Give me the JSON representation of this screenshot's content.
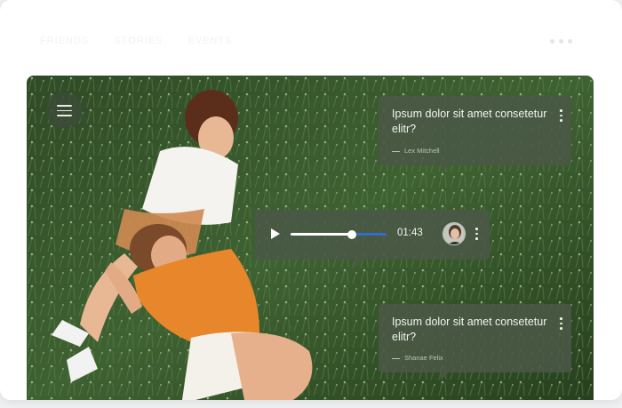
{
  "nav": {
    "items": [
      "FRIENDS",
      "STORIES",
      "EVENTS"
    ]
  },
  "messages": [
    {
      "text": "Ipsum dolor sit amet consetetur elitr?",
      "author": "Lex Mitchell"
    },
    {
      "text": "Ipsum dolor sit amet consetetur elitr?",
      "author": "Shanae Felix"
    }
  ],
  "player": {
    "time": "01:43",
    "progress": 0.64
  },
  "colors": {
    "bubble": "#4a5846",
    "track_accent": "#2f6fd0",
    "menu_button": "#3c4b37"
  }
}
